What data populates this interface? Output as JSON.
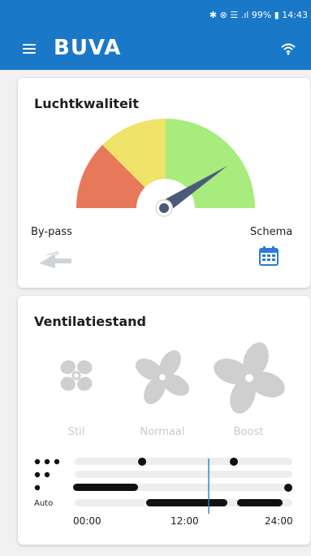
{
  "status_bar": {
    "text": "✱ ⊗ ☰ .ıl 99% ▮ 14:43",
    "battery": "99%",
    "time": "14:43"
  },
  "app_bar": {
    "brand": "BUVA",
    "color": "#1a78c8"
  },
  "air_quality": {
    "title": "Luchtkwaliteit",
    "bypass_label": "By-pass",
    "schedule_label": "Schema",
    "gauge_colors": [
      "#e8785a",
      "#f0e36a",
      "#a7ec7c"
    ],
    "needle_color": "#4a5a78"
  },
  "ventilation": {
    "title": "Ventilatiestand",
    "modes": [
      {
        "label": "Stil"
      },
      {
        "label": "Normaal"
      },
      {
        "label": "Boost"
      }
    ],
    "auto_label": "Auto",
    "times": [
      "00:00",
      "12:00",
      "24:00"
    ]
  }
}
